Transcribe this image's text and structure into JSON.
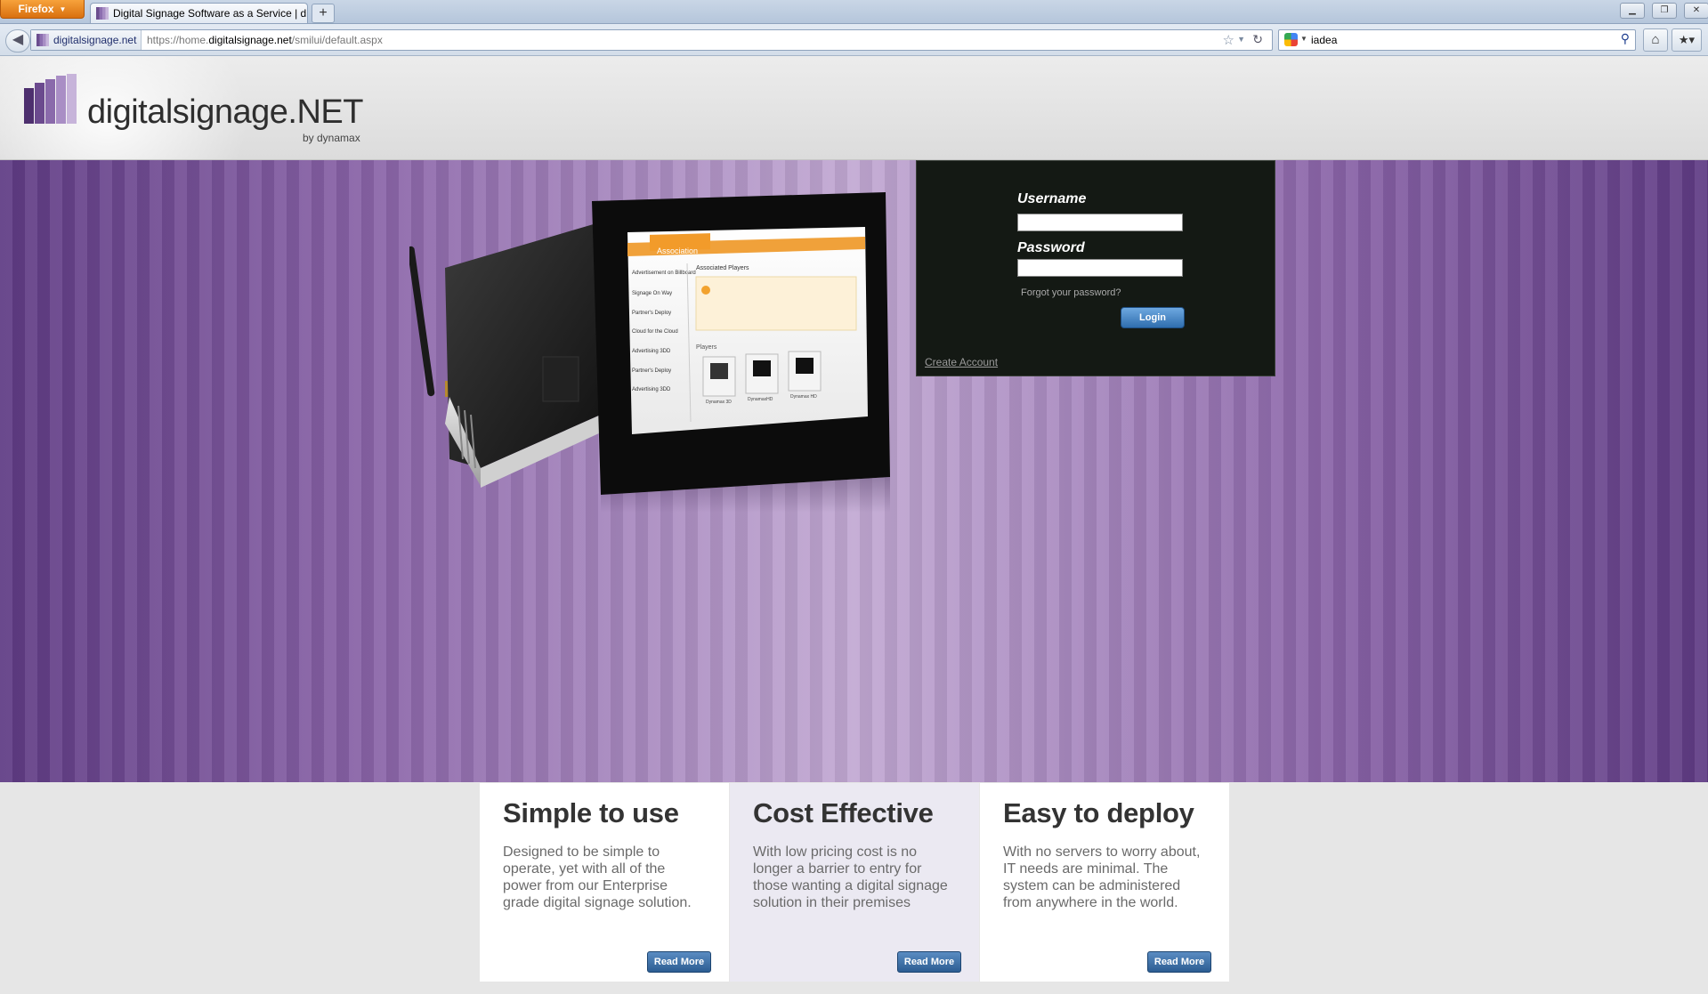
{
  "browser": {
    "menu_button": "Firefox",
    "tab_title": "Digital Signage Software as a Service | di...",
    "new_tab": "+",
    "site_identity": "digitalsignage.net",
    "url_prefix": "https://home.",
    "url_domain": "digitalsignage.net",
    "url_path": "/smilui/default.aspx",
    "search_query": "iadea",
    "icons": [
      "back-icon",
      "star-icon",
      "reload-icon",
      "search-engine-icon",
      "search-icon",
      "home-icon",
      "bookmarks-icon",
      "minimize-icon",
      "restore-icon",
      "close-icon"
    ]
  },
  "header": {
    "logo_text": "digitalsignage.NET",
    "logo_byline": "by dynamax"
  },
  "illustration": {
    "tab_label": "Association",
    "panel_title": "Associated Players",
    "players_heading": "Players",
    "list_items": [
      "Advertisement on Billboard",
      "Signage On Way",
      "Partner's Deploy",
      "Cloud for the Cloud",
      "Advertising 3DD",
      "Partner's Deploy",
      "Advertising 3DD"
    ],
    "player_labels": [
      "Dynamax 3D",
      "DynamaxHD",
      "Dynamax HD"
    ]
  },
  "login": {
    "username_label": "Username",
    "password_label": "Password",
    "username_value": "",
    "password_value": "",
    "forgot_link": "Forgot your password?",
    "login_button": "Login",
    "create_account": "Create Account"
  },
  "features": [
    {
      "title": "Simple to use",
      "body": "Designed to be simple to operate, yet with all of the power from our Enterprise grade digital signage solution.",
      "button": "Read More"
    },
    {
      "title": "Cost Effective",
      "body": "With low pricing cost is no longer a barrier to entry for those wanting a digital signage solution in their premises",
      "button": "Read More"
    },
    {
      "title": "Easy to deploy",
      "body": "With no servers to worry about, IT needs are minimal. The system can be administered from anywhere in the world.",
      "button": "Read More"
    }
  ],
  "colors": {
    "hero_purple": "#8a64a8",
    "login_bg": "#141914",
    "button_blue": "#2f6eae",
    "firefox_orange": "#e8871f"
  }
}
